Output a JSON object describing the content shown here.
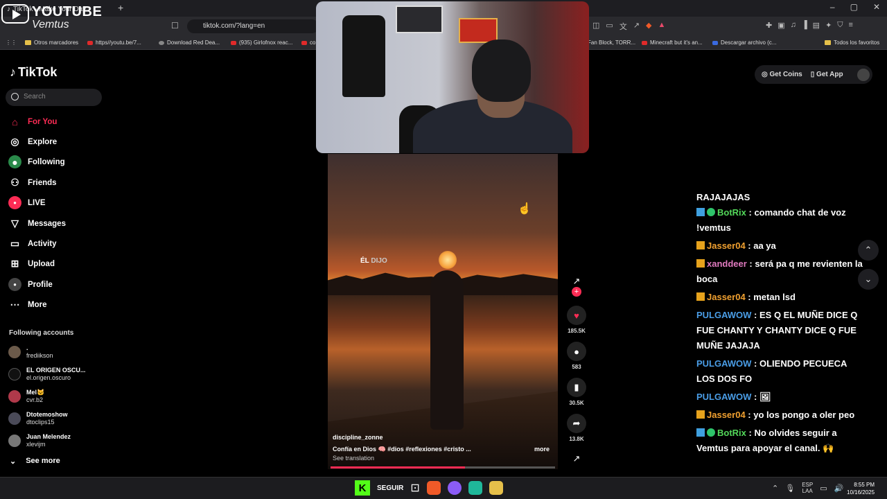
{
  "browser": {
    "tab_title": "TikTok - Make Your Day",
    "url": "tiktok.com/?lang=en",
    "window_controls": [
      "–",
      "▢",
      "✕"
    ],
    "bookmarks": [
      {
        "label": "Otros marcadores",
        "icon": "folder-icon"
      },
      {
        "label": "https//youtu.be/7...",
        "icon": "youtube-icon"
      },
      {
        "label": "Download Red Dea...",
        "icon": "globe-icon"
      },
      {
        "label": "(935) Girlofnox reac...",
        "icon": "youtube-icon"
      },
      {
        "label": "co",
        "icon": "youtube-icon"
      },
      {
        "label": "Fan Block, TORR...",
        "icon": "page-icon"
      },
      {
        "label": "Minecraft but it's an...",
        "icon": "youtube-icon"
      },
      {
        "label": "Descargar archivo (c...",
        "icon": "page-icon"
      },
      {
        "label": "Todos los favoritos",
        "icon": "folder-icon"
      }
    ]
  },
  "overlay": {
    "title": "YOUTUBE",
    "channel": "Vemtus"
  },
  "tiktok": {
    "logo": "TikTok",
    "search_placeholder": "Search",
    "nav": [
      {
        "label": "For You",
        "icon": "home-icon",
        "active": true
      },
      {
        "label": "Explore",
        "icon": "compass-icon"
      },
      {
        "label": "Following",
        "icon": "following-icon"
      },
      {
        "label": "Friends",
        "icon": "friends-icon"
      },
      {
        "label": "LIVE",
        "icon": "live-icon"
      },
      {
        "label": "Messages",
        "icon": "send-icon"
      },
      {
        "label": "Activity",
        "icon": "activity-icon"
      },
      {
        "label": "Upload",
        "icon": "upload-icon"
      },
      {
        "label": "Profile",
        "icon": "profile-icon"
      },
      {
        "label": "More",
        "icon": "more-icon"
      }
    ],
    "following_title": "Following accounts",
    "accounts": [
      {
        "name": ".",
        "handle": "frediikson"
      },
      {
        "name": "EL ORIGEN OSCU...",
        "handle": "el.origen.oscuro"
      },
      {
        "name": "Mel🐱",
        "handle": "cvr.b2"
      },
      {
        "name": "Dtotemoshow",
        "handle": "dtoclips15"
      },
      {
        "name": "Juan Melendez",
        "handle": "xlevijm"
      }
    ],
    "see_more": "See more",
    "get_coins": "Get Coins",
    "get_app": "Get App",
    "video": {
      "overlay_word1": "ÉL",
      "overlay_word2": "DIJO",
      "author": "discipline_zonne",
      "caption": "Confía en Dios 🧠 #dios #reflexiones #cristo ...",
      "see_translation": "See translation",
      "more": "more",
      "progress": 0.6
    },
    "actions": {
      "likes": "185.5K",
      "comments": "583",
      "saves": "30.5K",
      "shares": "13.8K"
    }
  },
  "chat": {
    "partial_top": "RAJAJAJAS",
    "messages": [
      {
        "user": "BotRix",
        "badges": [
          "bot",
          "check"
        ],
        "color": "green",
        "text": "comando chat de voz !vemtus"
      },
      {
        "user": "Jasser04",
        "badges": [
          "crown"
        ],
        "color": "orange",
        "text": "aa ya"
      },
      {
        "user": "xanddeer",
        "badges": [
          "crown"
        ],
        "color": "pink",
        "text": "será pa q me revienten la boca"
      },
      {
        "user": "Jasser04",
        "badges": [
          "crown"
        ],
        "color": "orange",
        "text": "metan lsd"
      },
      {
        "user": "PULGAWOW",
        "badges": [],
        "color": "blue",
        "text": "ES Q EL MUÑE DICE Q FUE CHANTY Y CHANTY DICE Q FUE MUÑE JAJAJA"
      },
      {
        "user": "PULGAWOW",
        "badges": [],
        "color": "blue",
        "text": "OLIENDO PECUECA LOS DOS FO"
      },
      {
        "user": "PULGAWOW",
        "badges": [],
        "color": "blue",
        "text": "🖼"
      },
      {
        "user": "Jasser04",
        "badges": [
          "crown"
        ],
        "color": "orange",
        "text": "yo los pongo a oler peo"
      },
      {
        "user": "BotRix",
        "badges": [
          "bot",
          "check"
        ],
        "color": "green",
        "text": "No olvides seguir a Vemtus para apoyar el canal. 🙌"
      }
    ]
  },
  "taskbar": {
    "follow_label": "SEGUIR",
    "lang_top": "ESP",
    "lang_bottom": "LAA",
    "time": "8:55 PM",
    "date": "10/16/2025"
  },
  "colors": {
    "tiktok_accent": "#fe2c55",
    "chat_green": "#53d85a",
    "chat_orange": "#f0a030",
    "chat_pink": "#e07abf",
    "chat_blue": "#4a9de6",
    "kick_green": "#53fc18"
  }
}
